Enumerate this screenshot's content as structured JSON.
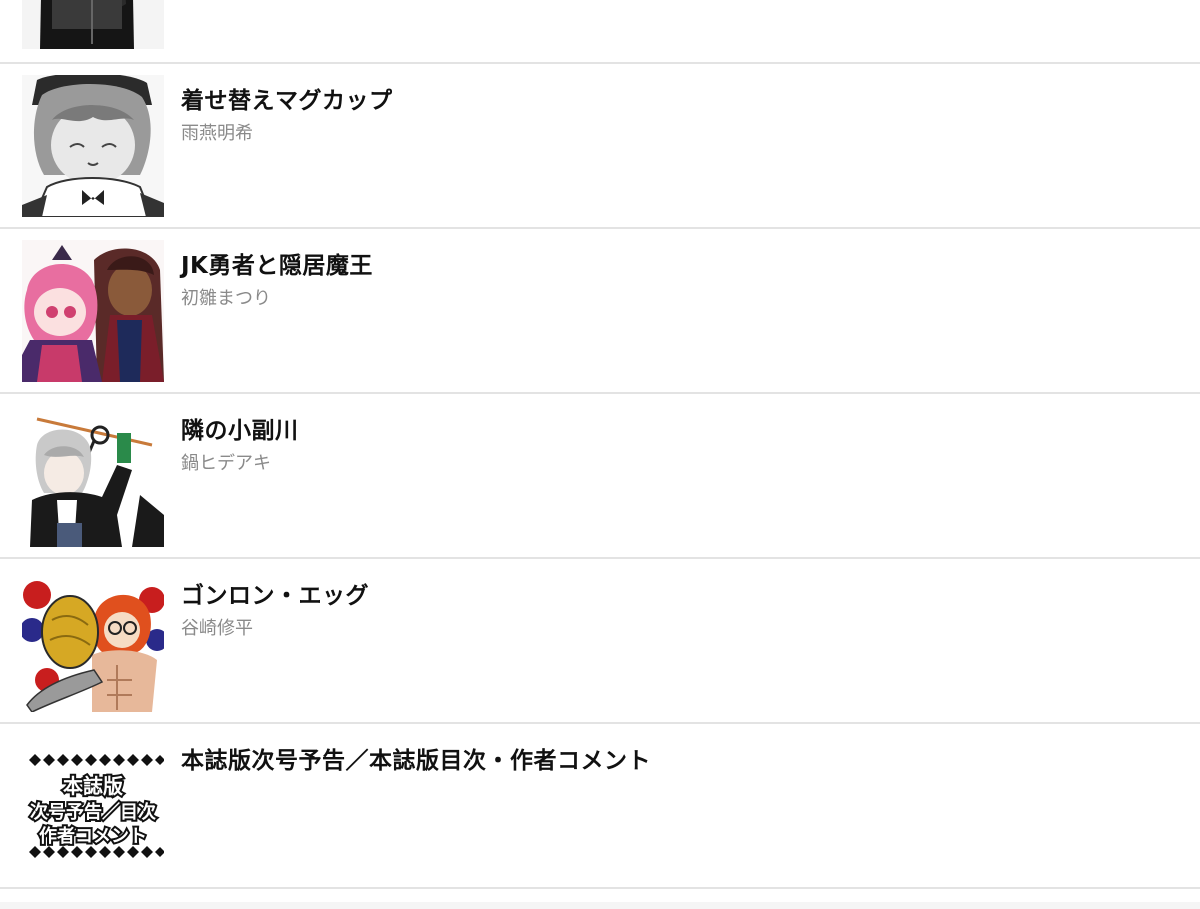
{
  "colors": {
    "background": "#ffffff",
    "divider": "#e3e3e3",
    "title": "#111111",
    "author": "#8a8a8a"
  },
  "list": {
    "items": [
      {
        "title": "",
        "author": "",
        "thumbnail": "partial-cover-art"
      },
      {
        "title": "着せ替えマグカップ",
        "author": "雨燕明希",
        "thumbnail": "grayscale-girl-cover"
      },
      {
        "title": "JK勇者と隠居魔王",
        "author": "初雛まつり",
        "thumbnail": "pink-hair-girl-and-dark-lord-cover"
      },
      {
        "title": "隣の小副川",
        "author": "鍋ヒデアキ",
        "thumbnail": "silver-hair-boy-cover"
      },
      {
        "title": "ゴンロン・エッグ",
        "author": "谷崎修平",
        "thumbnail": "golden-egg-cover"
      },
      {
        "title": "本誌版次号予告／本誌版目次・作者コメント",
        "author": "",
        "thumbnail": "text-banner",
        "thumbnail_text": [
          "本誌版",
          "次号予告／目次",
          "作者コメント"
        ]
      }
    ]
  }
}
